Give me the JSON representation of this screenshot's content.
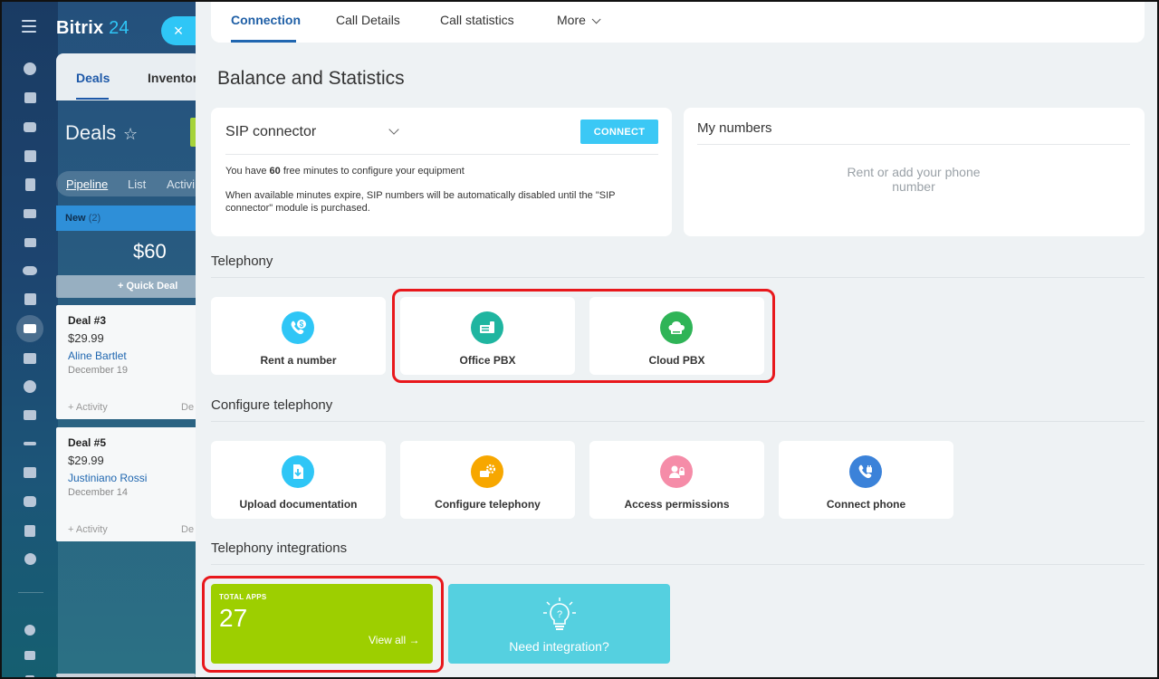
{
  "app": {
    "logo_text": "Bitrix",
    "logo_num": "24",
    "close_symbol": "×"
  },
  "rail_icons": [
    "menu-icon",
    "activity-stream-icon",
    "tasks-icon",
    "chat-icon",
    "calendar-icon",
    "documents-icon",
    "drive-icon",
    "mail-icon",
    "groups-icon",
    "checklist-icon",
    "crm-icon",
    "store-icon",
    "target-icon",
    "shop-icon",
    "sign-icon",
    "contact-center-icon",
    "robot-icon",
    "box-icon",
    "more-icon",
    "help-icon",
    "structure-icon",
    "settings-icon"
  ],
  "background_crm": {
    "tabs": [
      "Deals",
      "Inventor"
    ],
    "title": "Deals",
    "star": "☆",
    "views": [
      "Pipeline",
      "List",
      "Activi"
    ],
    "stage": {
      "name": "New",
      "count": "(2)"
    },
    "sum": "$60",
    "quick_deal": "Quick Deal",
    "deals": [
      {
        "title": "Deal #3",
        "price": "$29.99",
        "contact": "Aline Bartlet",
        "date": "December 19",
        "activity": "+ Activity",
        "extra": "De"
      },
      {
        "title": "Deal #5",
        "price": "$29.99",
        "contact": "Justiniano Rossi",
        "date": "December 14",
        "activity": "+ Activity",
        "extra": "De"
      }
    ]
  },
  "tabs": {
    "items": [
      {
        "label": "Connection",
        "active": true
      },
      {
        "label": "Call Details",
        "active": false
      },
      {
        "label": "Call statistics",
        "active": false
      },
      {
        "label": "More",
        "active": false
      }
    ]
  },
  "page_title": "Balance and Statistics",
  "sip": {
    "title": "SIP connector",
    "button": "CONNECT",
    "line1_pre": "You have ",
    "line1_bold": "60",
    "line1_post": " free minutes to configure your equipment",
    "line2": "When available minutes expire, SIP numbers will be automatically disabled until the \"SIP connector\" module is purchased."
  },
  "my_numbers": {
    "title": "My numbers",
    "empty": "Rent or add your phone number"
  },
  "telephony": {
    "title": "Telephony",
    "tiles": [
      {
        "label": "Rent a number",
        "icon": "dollar-phone-icon",
        "color": "#2fc6f6"
      },
      {
        "label": "Office PBX",
        "icon": "office-pbx-icon",
        "color": "#1fb5a0"
      },
      {
        "label": "Cloud PBX",
        "icon": "cloud-pbx-icon",
        "color": "#2fb457"
      }
    ]
  },
  "configure": {
    "title": "Configure telephony",
    "tiles": [
      {
        "label": "Upload documentation",
        "icon": "upload-document-icon",
        "color": "#2fc6f6"
      },
      {
        "label": "Configure telephony",
        "icon": "configure-gear-icon",
        "color": "#f7a700"
      },
      {
        "label": "Access permissions",
        "icon": "access-lock-icon",
        "color": "#f58ca8"
      },
      {
        "label": "Connect phone",
        "icon": "connect-phone-icon",
        "color": "#3b82d9"
      }
    ]
  },
  "integrations": {
    "title": "Telephony integrations",
    "apps_caption": "TOTAL APPS",
    "apps_count": "27",
    "view_all": "View all →",
    "need_label": "Need integration?"
  },
  "colors": {
    "accent": "#2066b0",
    "highlight": "#e8181c",
    "apps_green": "#9dcf00",
    "need_cyan": "#55d0e0",
    "connect_blue": "#3bc8f5"
  }
}
